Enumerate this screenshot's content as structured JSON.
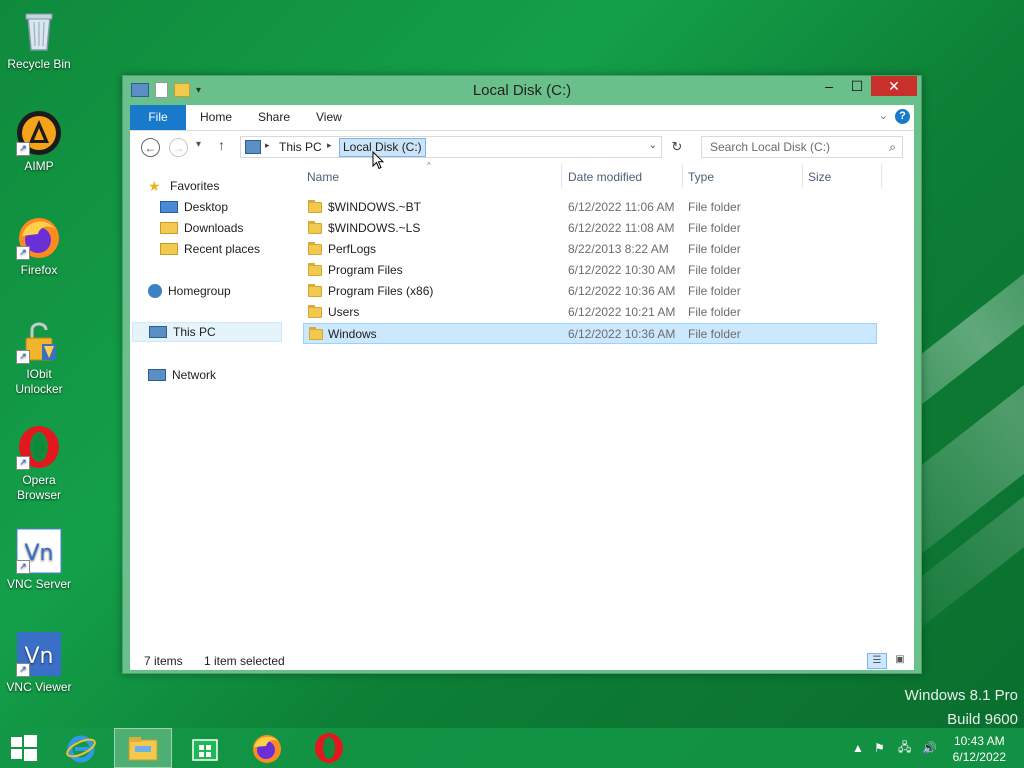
{
  "desktop": {
    "icons": [
      {
        "label": "Recycle Bin"
      },
      {
        "label": "AIMP"
      },
      {
        "label": "Firefox"
      },
      {
        "label": "IObit Unlocker"
      },
      {
        "label": "Opera Browser"
      },
      {
        "label": "VNC Server"
      },
      {
        "label": "VNC Viewer"
      }
    ],
    "watermark_line1": "Windows 8.1 Pro",
    "watermark_line2": "Build 9600"
  },
  "window": {
    "title": "Local Disk (C:)",
    "ribbon_tabs": [
      "File",
      "Home",
      "Share",
      "View"
    ],
    "address": {
      "crumbs": [
        "This PC",
        "Local Disk (C:)"
      ]
    },
    "search_placeholder": "Search Local Disk (C:)",
    "nav": {
      "favorites": "Favorites",
      "desktop": "Desktop",
      "downloads": "Downloads",
      "recent": "Recent places",
      "homegroup": "Homegroup",
      "thispc": "This PC",
      "network": "Network"
    },
    "columns": {
      "name": "Name",
      "date": "Date modified",
      "type": "Type",
      "size": "Size"
    },
    "files": [
      {
        "name": "$WINDOWS.~BT",
        "date": "6/12/2022 11:06 AM",
        "type": "File folder"
      },
      {
        "name": "$WINDOWS.~LS",
        "date": "6/12/2022 11:08 AM",
        "type": "File folder"
      },
      {
        "name": "PerfLogs",
        "date": "8/22/2013 8:22 AM",
        "type": "File folder"
      },
      {
        "name": "Program Files",
        "date": "6/12/2022 10:30 AM",
        "type": "File folder"
      },
      {
        "name": "Program Files (x86)",
        "date": "6/12/2022 10:36 AM",
        "type": "File folder"
      },
      {
        "name": "Users",
        "date": "6/12/2022 10:21 AM",
        "type": "File folder"
      },
      {
        "name": "Windows",
        "date": "6/12/2022 10:36 AM",
        "type": "File folder"
      }
    ],
    "status": {
      "items": "7 items",
      "selected": "1 item selected"
    }
  },
  "taskbar": {
    "time": "10:43 AM",
    "date": "6/12/2022"
  },
  "colors": {
    "accent": "#1979ca",
    "window_frame": "#6ac08a",
    "close": "#c7302b",
    "selection": "#cce8ff"
  }
}
